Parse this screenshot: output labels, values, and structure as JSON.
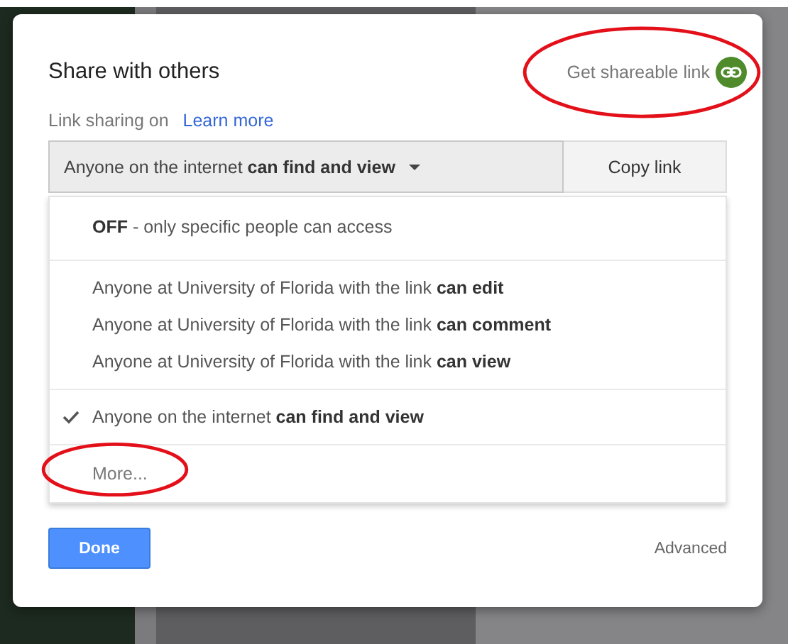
{
  "dialog": {
    "title": "Share with others",
    "get_link": {
      "label": "Get shareable link",
      "circled": true
    },
    "link_sharing": {
      "label": "Link sharing on",
      "link": "Learn more"
    },
    "access_dropdown": {
      "value": "Anyone on the internet **can find and view**",
      "expanded": true
    },
    "copy_button": "Copy link",
    "menu": {
      "sections": [
        [
          {
            "kind": "option",
            "label": "**OFF** - only specific people can access",
            "selected": false
          }
        ],
        [
          {
            "kind": "option",
            "label": "Anyone at University of Florida with the link **can edit**",
            "selected": false
          },
          {
            "kind": "option",
            "label": "Anyone at University of Florida with the link **can comment**",
            "selected": false
          },
          {
            "kind": "option",
            "label": "Anyone at University of Florida with the link **can view**",
            "selected": false
          }
        ],
        [
          {
            "kind": "option",
            "label": "Anyone on the internet **can find and view**",
            "selected": true
          }
        ],
        [
          {
            "kind": "more",
            "label": "More...",
            "circled": true
          }
        ]
      ]
    },
    "done_button": "Done",
    "advanced_link": "Advanced"
  }
}
